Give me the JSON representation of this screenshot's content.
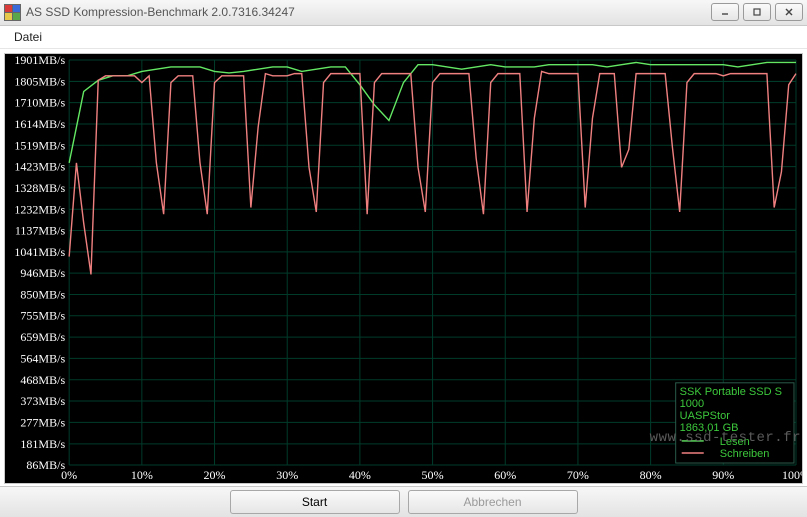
{
  "window": {
    "title": "AS SSD Kompression-Benchmark 2.0.7316.34247"
  },
  "menu": {
    "datei": "Datei"
  },
  "buttons": {
    "start": "Start",
    "abort": "Abbrechen"
  },
  "legend": {
    "device_line1": "SSK Portable SSD S",
    "device_line2": "1000",
    "device_line3": "UASPStor",
    "device_line4": "1863,01 GB",
    "read": "Lesen",
    "write": "Schreiben"
  },
  "watermark": "www.ssd-tester.fr",
  "chart_data": {
    "type": "line",
    "xlabel": "",
    "ylabel": "",
    "x_ticks": [
      "0%",
      "10%",
      "20%",
      "30%",
      "40%",
      "50%",
      "60%",
      "70%",
      "80%",
      "90%",
      "100%"
    ],
    "y_ticks": [
      "86MB/s",
      "181MB/s",
      "277MB/s",
      "373MB/s",
      "468MB/s",
      "564MB/s",
      "659MB/s",
      "755MB/s",
      "850MB/s",
      "946MB/s",
      "1041MB/s",
      "1137MB/s",
      "1232MB/s",
      "1328MB/s",
      "1423MB/s",
      "1519MB/s",
      "1614MB/s",
      "1710MB/s",
      "1805MB/s",
      "1901MB/s"
    ],
    "xlim": [
      0,
      100
    ],
    "ylim": [
      86,
      1901
    ],
    "series": [
      {
        "name": "Lesen",
        "color": "#64e864",
        "x": [
          0,
          2,
          4,
          6,
          8,
          10,
          12,
          14,
          16,
          18,
          20,
          22,
          24,
          26,
          28,
          30,
          32,
          34,
          36,
          38,
          40,
          42,
          44,
          46,
          48,
          50,
          52,
          54,
          56,
          58,
          60,
          62,
          64,
          66,
          68,
          70,
          72,
          74,
          76,
          78,
          80,
          82,
          84,
          86,
          88,
          90,
          92,
          94,
          96,
          98,
          100
        ],
        "y": [
          1440,
          1760,
          1810,
          1830,
          1830,
          1850,
          1860,
          1870,
          1870,
          1870,
          1850,
          1843,
          1850,
          1860,
          1870,
          1870,
          1850,
          1860,
          1870,
          1870,
          1790,
          1700,
          1630,
          1800,
          1880,
          1880,
          1870,
          1860,
          1870,
          1880,
          1870,
          1870,
          1870,
          1880,
          1880,
          1880,
          1880,
          1870,
          1880,
          1890,
          1880,
          1880,
          1880,
          1880,
          1880,
          1880,
          1870,
          1880,
          1890,
          1890,
          1890
        ]
      },
      {
        "name": "Schreiben",
        "color": "#f08080",
        "x": [
          0,
          1,
          2,
          3,
          4,
          5,
          6,
          7,
          8,
          9,
          10,
          11,
          12,
          13,
          14,
          15,
          16,
          17,
          18,
          19,
          20,
          21,
          22,
          23,
          24,
          25,
          26,
          27,
          28,
          29,
          30,
          31,
          32,
          33,
          34,
          35,
          36,
          37,
          38,
          39,
          40,
          41,
          42,
          43,
          44,
          45,
          46,
          47,
          48,
          49,
          50,
          51,
          52,
          53,
          54,
          55,
          56,
          57,
          58,
          59,
          60,
          61,
          62,
          63,
          64,
          65,
          66,
          67,
          68,
          69,
          70,
          71,
          72,
          73,
          74,
          75,
          76,
          77,
          78,
          79,
          80,
          81,
          82,
          83,
          84,
          85,
          86,
          87,
          88,
          89,
          90,
          91,
          92,
          93,
          94,
          95,
          96,
          97,
          98,
          99,
          100
        ],
        "y": [
          1020,
          1440,
          1170,
          940,
          1810,
          1830,
          1830,
          1830,
          1830,
          1830,
          1800,
          1830,
          1440,
          1210,
          1800,
          1830,
          1830,
          1830,
          1440,
          1210,
          1800,
          1830,
          1830,
          1830,
          1830,
          1240,
          1600,
          1840,
          1830,
          1830,
          1830,
          1840,
          1840,
          1420,
          1220,
          1800,
          1840,
          1840,
          1840,
          1840,
          1840,
          1210,
          1800,
          1840,
          1840,
          1840,
          1840,
          1840,
          1420,
          1220,
          1800,
          1840,
          1840,
          1840,
          1840,
          1840,
          1460,
          1210,
          1800,
          1840,
          1840,
          1840,
          1840,
          1220,
          1640,
          1850,
          1840,
          1840,
          1840,
          1840,
          1840,
          1240,
          1640,
          1840,
          1840,
          1840,
          1420,
          1500,
          1840,
          1840,
          1840,
          1840,
          1840,
          1510,
          1220,
          1800,
          1840,
          1840,
          1840,
          1840,
          1830,
          1840,
          1840,
          1840,
          1840,
          1840,
          1840,
          1240,
          1400,
          1790,
          1840
        ]
      }
    ]
  }
}
